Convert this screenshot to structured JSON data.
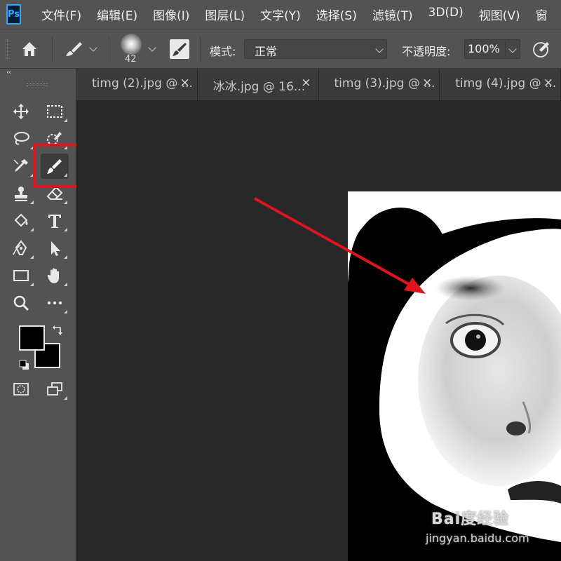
{
  "app": {
    "logo_text": "Ps"
  },
  "menu": [
    "文件(F)",
    "编辑(E)",
    "图像(I)",
    "图层(L)",
    "文字(Y)",
    "选择(S)",
    "滤镜(T)",
    "3D(D)",
    "视图(V)",
    "窗"
  ],
  "options": {
    "brush_size": "42",
    "mode_label": "模式:",
    "mode_value": "正常",
    "opacity_label": "不透明度:",
    "opacity_value": "100%"
  },
  "toolbar": {
    "collapse_glyph": "‹‹",
    "selected_tool": "brush-tool",
    "tools": [
      "move",
      "marquee",
      "lasso",
      "quick-selection",
      "eyedropper",
      "brush",
      "clone-stamp",
      "eraser",
      "paint-bucket",
      "type",
      "pen",
      "path-selection",
      "rectangle",
      "hand",
      "zoom",
      "more",
      "quick-mask",
      "screen-mode"
    ],
    "foreground_color": "#000000",
    "background_color": "#000000"
  },
  "tabs": [
    {
      "label": "timg (2).jpg @ ..."
    },
    {
      "label": "冰冰.jpg @ 16..."
    },
    {
      "label": "timg (3).jpg @ ..."
    },
    {
      "label": "timg (4).jpg @ ..."
    }
  ],
  "watermark": {
    "brand": "Bai度经验",
    "url": "jingyan.baidu.com"
  },
  "annotation": {
    "highlight_color": "#e0141e",
    "arrow_color": "#e0141e"
  }
}
